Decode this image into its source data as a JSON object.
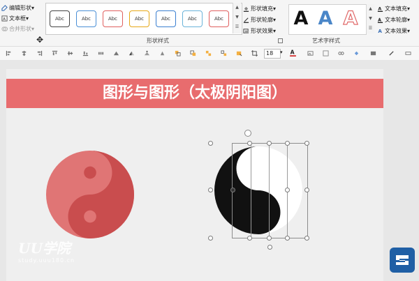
{
  "ribbon": {
    "left_group": [
      {
        "label": "编辑形状",
        "icon": "edit-shape-icon",
        "disabled": false
      },
      {
        "label": "文本框",
        "icon": "textbox-icon",
        "disabled": false
      },
      {
        "label": "合并形状",
        "icon": "merge-shapes-icon",
        "disabled": true
      }
    ],
    "shape_style_gallery": {
      "label": "形状样式",
      "thumb_text": "Abc",
      "thumb_colors": [
        "#444444",
        "#4a8fd6",
        "#e0605f",
        "#e6a817",
        "#3a7fd0",
        "#6ab3d9",
        "#e0605f"
      ]
    },
    "shape_options": [
      {
        "label": "形状填充",
        "icon": "shape-fill-icon"
      },
      {
        "label": "形状轮廓",
        "icon": "shape-outline-icon"
      },
      {
        "label": "形状效果",
        "icon": "shape-effects-icon"
      }
    ],
    "wordart": {
      "label": "艺术字样式",
      "letters": [
        {
          "text": "A",
          "color": "#111111"
        },
        {
          "text": "A",
          "color": "#4a86c8"
        },
        {
          "text": "A",
          "color": "#e06a6a"
        }
      ]
    },
    "text_options": [
      {
        "label": "文本填充",
        "icon": "text-fill-icon"
      },
      {
        "label": "文本轮廓",
        "icon": "text-outline-icon"
      },
      {
        "label": "文本效果",
        "icon": "text-effects-icon"
      }
    ]
  },
  "toolbar2": {
    "font_size": "18"
  },
  "slide": {
    "title": "图形与图形（太极阴阳图）",
    "accent_color": "#e86c6e"
  },
  "watermark": {
    "main": "UU学院",
    "sub": "study.uuu180.cn"
  }
}
